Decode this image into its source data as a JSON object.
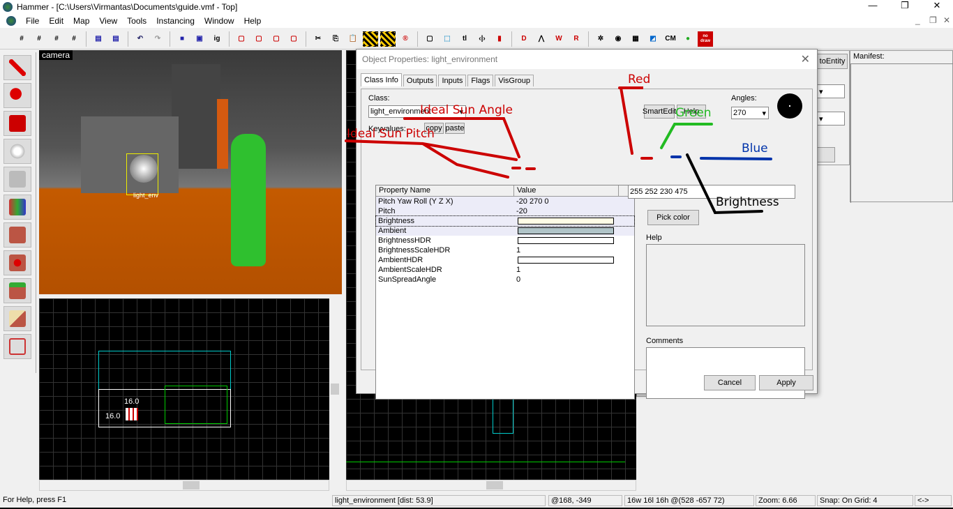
{
  "window": {
    "title": "Hammer - [C:\\Users\\Virmantas\\Documents\\guide.vmf - Top]",
    "min": "—",
    "max": "❐",
    "close": "✕"
  },
  "menu": [
    "File",
    "Edit",
    "Map",
    "View",
    "Tools",
    "Instancing",
    "Window",
    "Help"
  ],
  "toolbar": {
    "text_buttons": [
      "ig",
      "tl",
      "CM",
      "no draw"
    ]
  },
  "viewports": {
    "camera_label": "camera",
    "entity_label": "light_env",
    "dim_w": "16.0",
    "dim_h": "16.0"
  },
  "dialog": {
    "title": "Object Properties: light_environment",
    "tabs": [
      "Class Info",
      "Outputs",
      "Inputs",
      "Flags",
      "VisGroup"
    ],
    "class_label": "Class:",
    "class_value": "light_environment",
    "keyvalues_label": "Keyvalues:",
    "copy": "copy",
    "paste": "paste",
    "smartedit": "SmartEdit",
    "help_btn": "Help",
    "angles_label": "Angles:",
    "angles_value": "270",
    "columns": [
      "Property Name",
      "Value"
    ],
    "rows": [
      {
        "name": "Pitch Yaw Roll (Y Z X)",
        "value": "-20 270 0"
      },
      {
        "name": "Pitch",
        "value": "-20"
      },
      {
        "name": "Brightness",
        "swatch": "#fffce6"
      },
      {
        "name": "Ambient",
        "swatch": "#b0c4c8"
      },
      {
        "name": "BrightnessHDR",
        "swatch": "#ffffff"
      },
      {
        "name": "BrightnessScaleHDR",
        "value": "1"
      },
      {
        "name": "AmbientHDR",
        "swatch": "#ffffff"
      },
      {
        "name": "AmbientScaleHDR",
        "value": "1"
      },
      {
        "name": "SunSpreadAngle",
        "value": "0"
      }
    ],
    "color_value": "255 252 230 475",
    "pick_color": "Pick color",
    "help_label": "Help",
    "comments_label": "Comments",
    "cancel": "Cancel",
    "apply": "Apply"
  },
  "annotations": {
    "red": "Red",
    "green": "Green",
    "blue": "Blue",
    "brightness": "Brightness",
    "sun_angle": "Ideal Sun Angle",
    "sun_pitch": "Ideal Sun Pitch"
  },
  "right_panel": {
    "goto_entity": "toEntity",
    "manifest": "Manifest:"
  },
  "status": {
    "help": "For Help, press F1",
    "selection": "light_environment  [dist: 53.9]",
    "coords": "@168, -349",
    "size": "16w 16l 16h @(528 -657 72)",
    "zoom": "Zoom: 6.66",
    "snap": "Snap: On Grid: 4",
    "arrows": "<->"
  }
}
